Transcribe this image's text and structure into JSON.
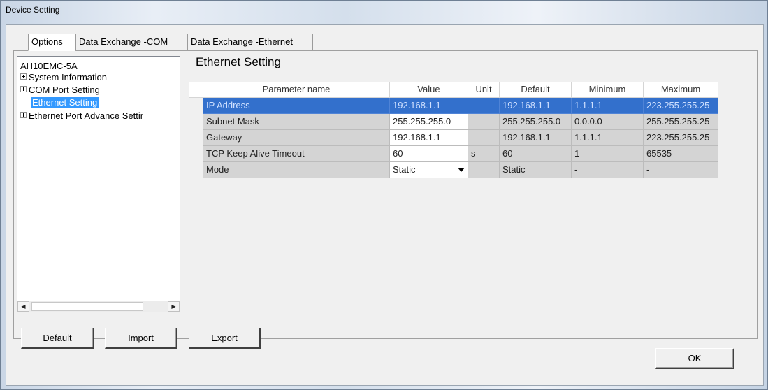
{
  "window": {
    "title": "Device Setting"
  },
  "tabs": [
    {
      "label": "Options"
    },
    {
      "label": "Data Exchange -COM"
    },
    {
      "label": "Data Exchange -Ethernet"
    }
  ],
  "tree": {
    "root": "AH10EMC-5A",
    "items": [
      {
        "label": "System Information",
        "expandable": true
      },
      {
        "label": "COM Port Setting",
        "expandable": true
      },
      {
        "label": "Ethernet Setting",
        "expandable": false,
        "selected": true
      },
      {
        "label": "Ethernet Port Advance Settir",
        "expandable": true
      }
    ]
  },
  "section_title": "Ethernet Setting",
  "grid": {
    "columns": [
      "Parameter name",
      "Value",
      "Unit",
      "Default",
      "Minimum",
      "Maximum"
    ],
    "rows": [
      {
        "name": "IP Address",
        "value": "192.168.1.1",
        "unit": "",
        "default": "192.168.1.1",
        "min": "1.1.1.1",
        "max": "223.255.255.25"
      },
      {
        "name": "Subnet Mask",
        "value": "255.255.255.0",
        "unit": "",
        "default": "255.255.255.0",
        "min": "0.0.0.0",
        "max": "255.255.255.25"
      },
      {
        "name": "Gateway",
        "value": "192.168.1.1",
        "unit": "",
        "default": "192.168.1.1",
        "min": "1.1.1.1",
        "max": "223.255.255.25"
      },
      {
        "name": "TCP Keep Alive Timeout",
        "value": "60",
        "unit": "s",
        "default": "60",
        "min": "1",
        "max": "65535"
      },
      {
        "name": "Mode",
        "value": "Static",
        "unit": "",
        "default": "Static",
        "min": "-",
        "max": "-"
      }
    ]
  },
  "buttons": {
    "default": "Default",
    "import": "Import",
    "export": "Export",
    "ok": "OK"
  },
  "colors": {
    "selection": "#3370cc",
    "tree_selection": "#3399ff",
    "readonly_cell": "#d4d4d4"
  }
}
